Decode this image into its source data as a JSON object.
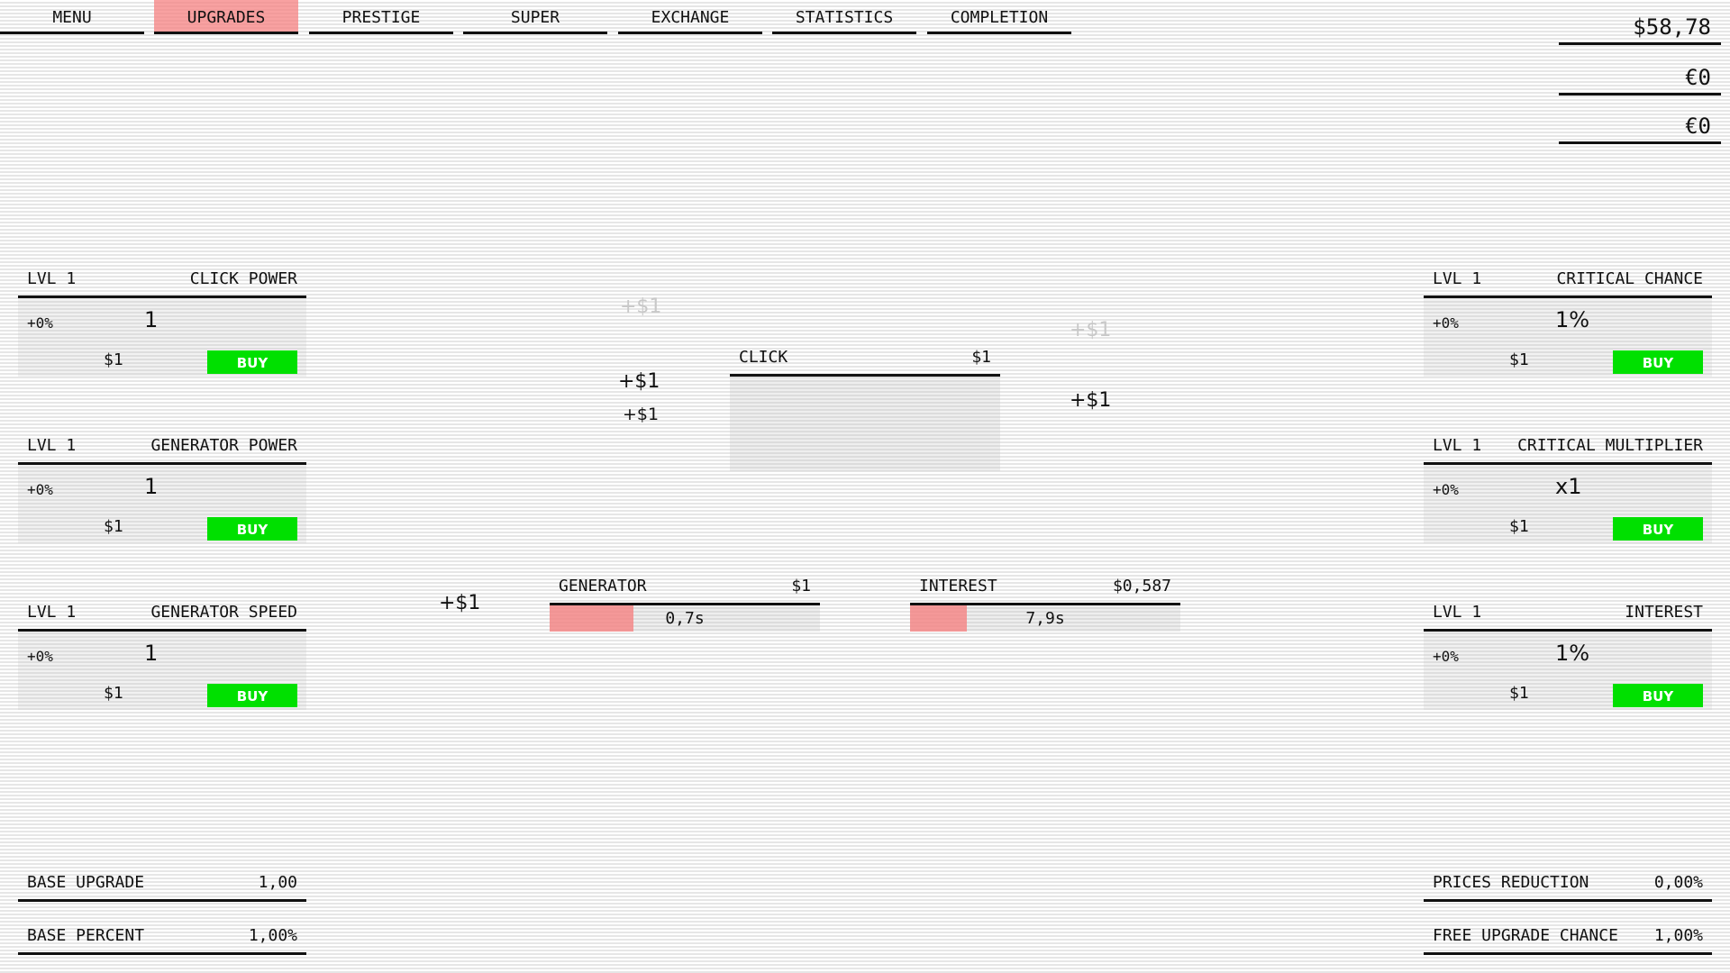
{
  "nav": {
    "tabs": [
      {
        "label": "MENU",
        "active": false
      },
      {
        "label": "UPGRADES",
        "active": true
      },
      {
        "label": "PRESTIGE",
        "active": false
      },
      {
        "label": "SUPER",
        "active": false
      },
      {
        "label": "EXCHANGE",
        "active": false
      },
      {
        "label": "STATISTICS",
        "active": false
      },
      {
        "label": "COMPLETION",
        "active": false
      }
    ]
  },
  "currencies": [
    "$58,78",
    "€0",
    "€0"
  ],
  "upgrades_left": [
    {
      "level": "LVL 1",
      "name": "CLICK POWER",
      "bonus": "+0%",
      "value": "1",
      "cost": "$1",
      "buy_label": "BUY"
    },
    {
      "level": "LVL 1",
      "name": "GENERATOR POWER",
      "bonus": "+0%",
      "value": "1",
      "cost": "$1",
      "buy_label": "BUY"
    },
    {
      "level": "LVL 1",
      "name": "GENERATOR SPEED",
      "bonus": "+0%",
      "value": "1",
      "cost": "$1",
      "buy_label": "BUY"
    }
  ],
  "upgrades_right": [
    {
      "level": "LVL 1",
      "name": "CRITICAL CHANCE",
      "bonus": "+0%",
      "value": "1%",
      "cost": "$1",
      "buy_label": "BUY"
    },
    {
      "level": "LVL 1",
      "name": "CRITICAL MULTIPLIER",
      "bonus": "+0%",
      "value": "x1",
      "cost": "$1",
      "buy_label": "BUY"
    },
    {
      "level": "LVL 1",
      "name": "INTEREST",
      "bonus": "+0%",
      "value": "1%",
      "cost": "$1",
      "buy_label": "BUY"
    }
  ],
  "click": {
    "label": "CLICK",
    "value": "$1"
  },
  "generator": {
    "label": "GENERATOR",
    "value": "$1",
    "time": "0,7s",
    "progress": 0.31
  },
  "interest": {
    "label": "INTEREST",
    "value": "$0,587",
    "time": "7,9s",
    "progress": 0.21
  },
  "floating_gains": [
    "+$1",
    "+$1",
    "+$1",
    "+$1",
    "+$1",
    "+$1"
  ],
  "stats_left": [
    {
      "label": "BASE UPGRADE",
      "value": "1,00"
    },
    {
      "label": "BASE PERCENT",
      "value": "1,00%"
    }
  ],
  "stats_right": [
    {
      "label": "PRICES REDUCTION",
      "value": "0,00%"
    },
    {
      "label": "FREE UPGRADE CHANCE",
      "value": "1,00%"
    }
  ],
  "colors": {
    "accent": "#f58282",
    "buy": "#00e000"
  }
}
